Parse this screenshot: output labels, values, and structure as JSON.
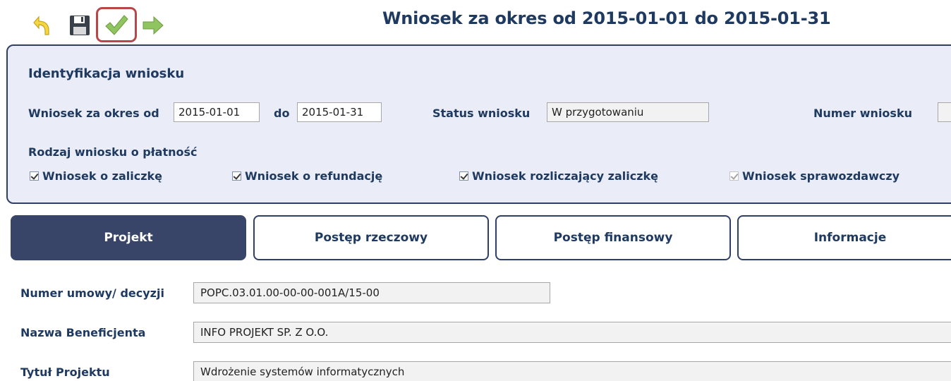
{
  "toolbar": {
    "undo_icon": "undo-arrow-icon",
    "save_icon": "floppy-disk-icon",
    "validate_icon": "checkmark-icon",
    "forward_icon": "forward-arrow-icon"
  },
  "page_title": "Wniosek za okres od 2015-01-01 do 2015-01-31",
  "identification": {
    "title": "Identyfikacja wniosku",
    "period_from_label": "Wniosek za okres od",
    "period_from_value": "2015-01-01",
    "period_to_label": "do",
    "period_to_value": "2015-01-31",
    "status_label": "Status wniosku",
    "status_value": "W przygotowaniu",
    "number_label": "Numer wniosku",
    "number_value": "",
    "payment_type_label": "Rodzaj wniosku o płatność",
    "checkboxes": [
      {
        "label": "Wniosek o zaliczkę",
        "checked": true,
        "enabled": true
      },
      {
        "label": "Wniosek o refundację",
        "checked": true,
        "enabled": true
      },
      {
        "label": "Wniosek rozliczający zaliczkę",
        "checked": true,
        "enabled": true
      },
      {
        "label": "Wniosek sprawozdawczy",
        "checked": true,
        "enabled": false
      }
    ]
  },
  "tabs": [
    {
      "label": "Projekt",
      "active": true
    },
    {
      "label": "Postęp rzeczowy",
      "active": false
    },
    {
      "label": "Postęp finansowy",
      "active": false
    },
    {
      "label": "Informacje",
      "active": false
    }
  ],
  "project": {
    "agreement_label": "Numer umowy/ decyzji",
    "agreement_value": "POPC.03.01.00-00-00-001A/15-00",
    "beneficiary_label": "Nazwa Beneficjenta",
    "beneficiary_value": "INFO PROJEKT SP. Z O.O.",
    "title_label": "Tytuł Projektu",
    "title_value": "Wdrożenie systemów informatycznych"
  },
  "colors": {
    "title_text": "#1f3a60",
    "panel_bg": "#eaedf7",
    "panel_border": "#2f3f68",
    "active_tab_bg": "#384569",
    "highlight_border": "#b9474a"
  }
}
